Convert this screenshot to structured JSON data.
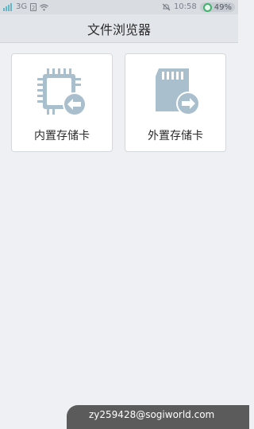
{
  "status_bar": {
    "network_type": "3G",
    "sim_label": "2",
    "time": "10:58",
    "battery_percent": "49%",
    "icons": [
      "signal-icon",
      "sim-icon",
      "wifi-icon",
      "mute-icon",
      "battery-icon"
    ]
  },
  "header": {
    "title": "文件浏览器"
  },
  "storage_cards": {
    "internal_label": "内置存储卡",
    "external_label": "外置存储卡",
    "internal_icon": "chip-back-arrow-icon",
    "external_icon": "sdcard-forward-arrow-icon"
  },
  "watermark": {
    "text": "zy259428@sogiworld.com"
  },
  "colors": {
    "accent_blue": "#a9bfcd",
    "battery_green": "#3cb46b"
  }
}
